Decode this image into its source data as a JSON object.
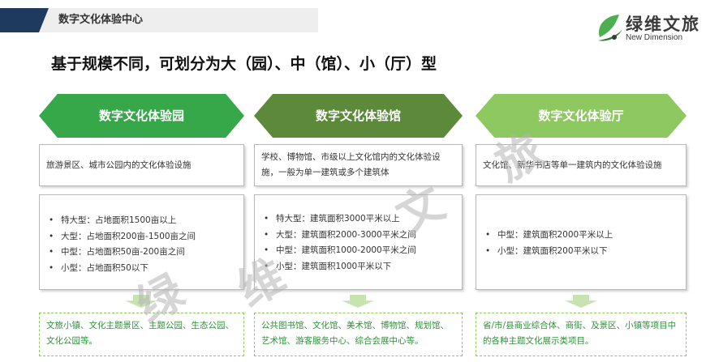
{
  "header": {
    "title": "数字文化体验中心"
  },
  "logo": {
    "cn": "绿维文旅",
    "en": "New Dimension"
  },
  "main_title": "基于规模不同，可划分为大（园）、中（馆）、小（厅）型",
  "watermark": {
    "c1": "绿",
    "c2": "维",
    "c3": "文",
    "c4": "旅"
  },
  "colors": {
    "dark_green": "#37a84a",
    "mid_green": "#5d8a3a",
    "light_green": "#8dc860",
    "example_text": "#2f8f3a"
  },
  "columns": [
    {
      "title": "数字文化体验园",
      "desc": "旅游景区、城市公园内的文化体验设施",
      "items": [
        "特大型：占地面积1500亩以上",
        "大型：占地面积200亩-1500亩之间",
        "中型：占地面积50亩-200亩之间",
        "小型：占地面积50以下"
      ],
      "examples": "文旅小镇、文化主题景区、主题公园、生态公园、文化公园等。"
    },
    {
      "title": "数字文化体验馆",
      "desc": "学校、博物馆、市级以上文化馆内的文化体验设施，一般为单一建筑或多个建筑体",
      "items": [
        "特大型：建筑面积3000平米以上",
        "大型：建筑面积2000-3000平米之间",
        "中型：建筑面积1000-2000平米之间",
        "小型：建筑面积1000平米以下"
      ],
      "examples": "公共图书馆、文化馆、美术馆、博物馆、规划馆、艺术馆、游客服务中心、综合会展中心等。"
    },
    {
      "title": "数字文化体验厅",
      "desc": "文化馆、新华书店等单一建筑内的文化体验设施",
      "items": [
        "中型：建筑面积2000平米以上",
        "小型：建筑面积200平米以下"
      ],
      "examples": "省/市/县商业综合体、商街、及景区、小镇等项目中的各种主题文化展示类项目。"
    }
  ]
}
